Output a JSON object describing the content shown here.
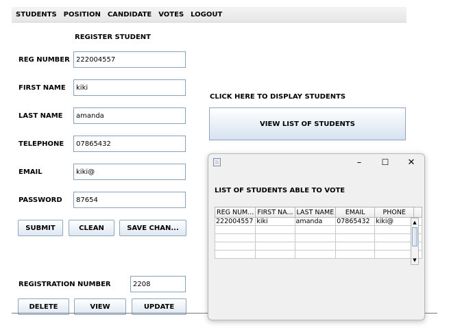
{
  "menu": [
    "STUDENTS",
    "POSITION",
    "CANDIDATE",
    "VOTES",
    "LOGOUT"
  ],
  "form": {
    "heading": "REGISTER STUDENT",
    "reg_number_label": "REG NUMBER",
    "reg_number_value": "222004557",
    "first_name_label": "FIRST NAME",
    "first_name_value": "kiki",
    "last_name_label": "LAST NAME",
    "last_name_value": "amanda",
    "telephone_label": "TELEPHONE",
    "telephone_value": "07865432",
    "email_label": "EMAIL",
    "email_value": "kiki@",
    "password_label": "PASSWORD",
    "password_value": "87654",
    "submit_label": "SUBMIT",
    "clean_label": "CLEAN",
    "save_label": "SAVE CHAN..."
  },
  "lookup": {
    "label": "REGISTRATION NUMBER",
    "value": "2208",
    "delete_label": "DELETE",
    "view_label": "VIEW",
    "update_label": "UPDATE"
  },
  "display": {
    "heading": "CLICK HERE TO DISPLAY STUDENTS",
    "button_label": "VIEW LIST OF STUDENTS"
  },
  "dialog": {
    "minimize": "–",
    "maximize": "☐",
    "close": "✕",
    "title": "LIST OF  STUDENTS ABLE TO VOTE",
    "columns": [
      "REG NUM...",
      "FIRST NA...",
      "LAST NAME",
      "EMAIL",
      "PHONE"
    ],
    "rows": [
      [
        "222004557",
        "kiki",
        "amanda",
        "07865432",
        "kiki@"
      ]
    ]
  }
}
